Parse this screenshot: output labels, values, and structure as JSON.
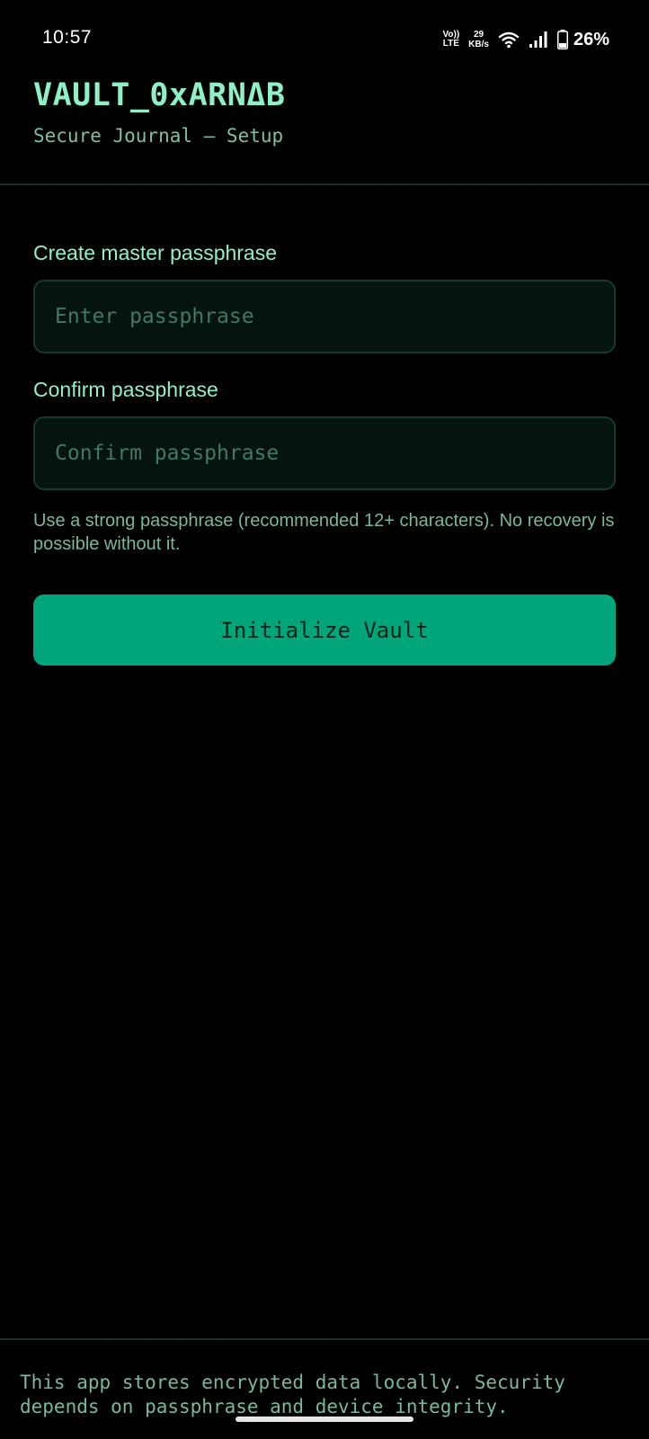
{
  "status_bar": {
    "time": "10:57",
    "volte_top": "Vo))",
    "volte_bottom": "LTE",
    "net_speed_value": "29",
    "net_speed_unit": "KB/s",
    "battery_percent": "26%",
    "icons": [
      "wifi-icon",
      "signal-icon",
      "battery-icon"
    ]
  },
  "header": {
    "title": "VAULT_0xARNΔB",
    "subtitle": "Secure Journal — Setup"
  },
  "form": {
    "master_label": "Create master passphrase",
    "master_placeholder": "Enter passphrase",
    "master_value": "",
    "confirm_label": "Confirm passphrase",
    "confirm_placeholder": "Confirm passphrase",
    "confirm_value": "",
    "helper_text": "Use a strong passphrase (recommended 12+ characters). No recovery is possible without it.",
    "submit_label": "Initialize Vault"
  },
  "footer": {
    "text": "This app stores encrypted data locally. Security depends on passphrase and device integrity."
  },
  "colors": {
    "background": "#000000",
    "accent": "#00a67a",
    "title_text": "#8ef0c4",
    "muted_text": "#79b89c",
    "input_background": "#051411",
    "input_border": "#163a2f"
  }
}
